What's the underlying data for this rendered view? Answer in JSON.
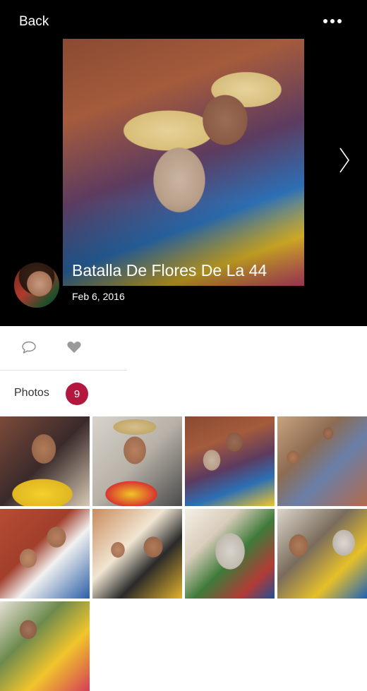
{
  "header": {
    "back_label": "Back",
    "more_icon": "more-horizontal-icon"
  },
  "album": {
    "title": "Batalla De Flores De La 44",
    "date": "Feb 6, 2016",
    "next_icon": "chevron-right-icon",
    "avatar_icon": "user-avatar"
  },
  "actions": {
    "comment_icon": "comment-icon",
    "like_icon": "heart-icon"
  },
  "photos": {
    "label": "Photos",
    "count": "9",
    "badge_color": "#b3173e"
  }
}
